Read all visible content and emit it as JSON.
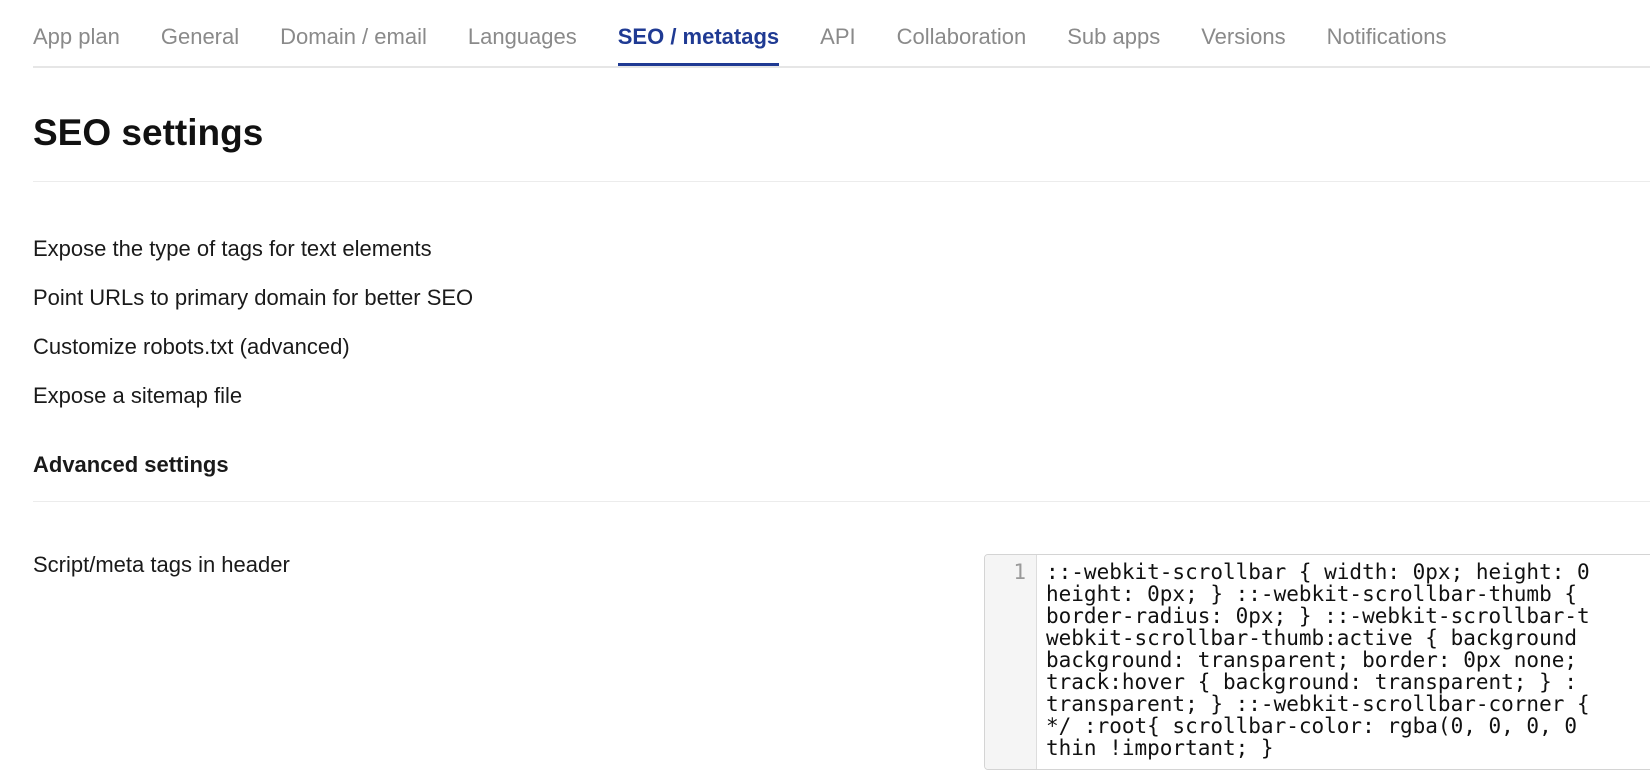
{
  "tabs": [
    {
      "label": "App plan",
      "active": false
    },
    {
      "label": "General",
      "active": false
    },
    {
      "label": "Domain / email",
      "active": false
    },
    {
      "label": "Languages",
      "active": false
    },
    {
      "label": "SEO / metatags",
      "active": true
    },
    {
      "label": "API",
      "active": false
    },
    {
      "label": "Collaboration",
      "active": false
    },
    {
      "label": "Sub apps",
      "active": false
    },
    {
      "label": "Versions",
      "active": false
    },
    {
      "label": "Notifications",
      "active": false
    }
  ],
  "page": {
    "title": "SEO settings"
  },
  "options": [
    "Expose the type of tags for text elements",
    "Point URLs to primary domain for better SEO",
    "Customize robots.txt (advanced)",
    "Expose a sitemap file"
  ],
  "advanced": {
    "title": "Advanced settings",
    "header_tags_label": "Script/meta tags in header"
  },
  "editor": {
    "line_number": "1",
    "lines": [
      "::-webkit-scrollbar { width: 0px; height: 0",
      "height: 0px; } ::-webkit-scrollbar-thumb {",
      "border-radius: 0px; } ::-webkit-scrollbar-t",
      "webkit-scrollbar-thumb:active { background",
      "background: transparent; border: 0px none;",
      "track:hover { background: transparent; } :",
      "transparent; } ::-webkit-scrollbar-corner {",
      "*/ :root{ scrollbar-color: rgba(0, 0, 0, 0",
      "thin !important; }"
    ]
  },
  "colors": {
    "accent": "#1f3a93",
    "inactive_tab": "#8a8a8a",
    "divider": "#ececec"
  }
}
